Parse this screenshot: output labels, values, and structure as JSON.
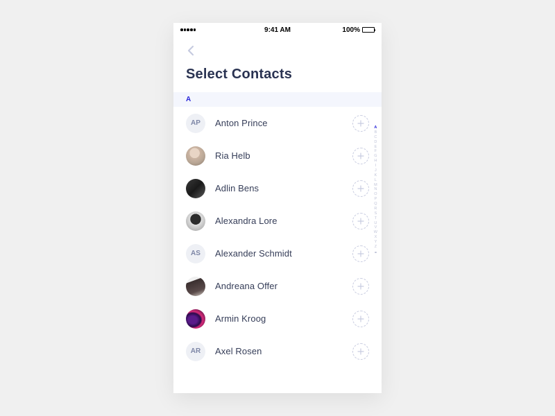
{
  "status": {
    "time": "9:41 AM",
    "battery": "100%"
  },
  "header": {
    "title": "Select Contacts"
  },
  "section": {
    "label": "A"
  },
  "contacts": [
    {
      "initials": "AP",
      "name": "Anton Prince",
      "avatarClass": ""
    },
    {
      "initials": "",
      "name": "Ria Helb",
      "avatarClass": "img-1"
    },
    {
      "initials": "",
      "name": "Adlin Bens",
      "avatarClass": "img-2"
    },
    {
      "initials": "",
      "name": "Alexandra Lore",
      "avatarClass": "img-3"
    },
    {
      "initials": "AS",
      "name": "Alexander Schmidt",
      "avatarClass": ""
    },
    {
      "initials": "",
      "name": "Andreana Offer",
      "avatarClass": "img-4"
    },
    {
      "initials": "",
      "name": "Armin Kroog",
      "avatarClass": "img-5"
    },
    {
      "initials": "AR",
      "name": "Axel Rosen",
      "avatarClass": ""
    }
  ],
  "index": [
    "A",
    "B",
    "C",
    "D",
    "E",
    "F",
    "G",
    "H",
    "I",
    "J",
    "K",
    "L",
    "M",
    "N",
    "O",
    "P",
    "Q",
    "R",
    "S",
    "T",
    "U",
    "V",
    "W",
    "X",
    "Y",
    "Z"
  ],
  "indexActive": "A"
}
